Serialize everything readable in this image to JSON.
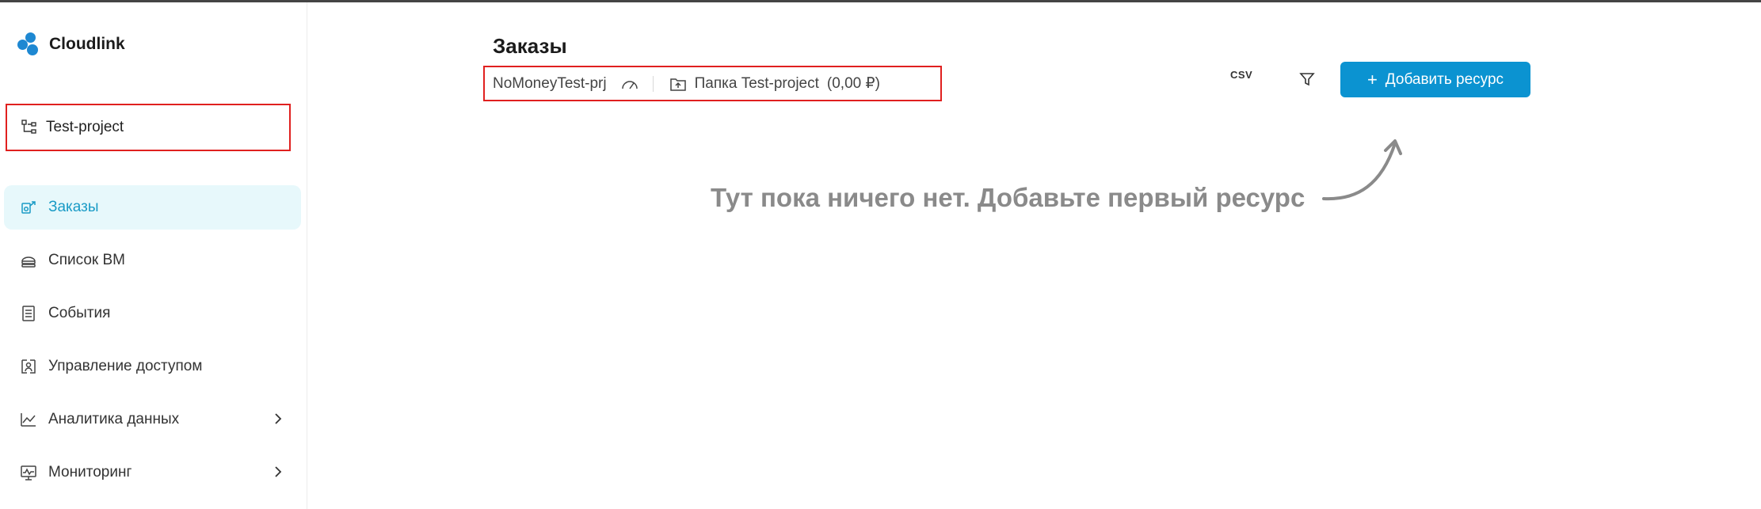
{
  "app": {
    "name": "Cloudlink"
  },
  "project": {
    "name": "Test-project"
  },
  "sidebar": {
    "items": [
      {
        "label": "Заказы",
        "active": true,
        "icon": "orders-icon"
      },
      {
        "label": "Список ВМ",
        "active": false,
        "icon": "vm-list-icon"
      },
      {
        "label": "События",
        "active": false,
        "icon": "events-icon"
      },
      {
        "label": "Управление доступом",
        "active": false,
        "icon": "access-icon"
      },
      {
        "label": "Аналитика данных",
        "active": false,
        "icon": "analytics-icon",
        "expandable": true
      },
      {
        "label": "Мониторинг",
        "active": false,
        "icon": "monitoring-icon",
        "expandable": true
      }
    ]
  },
  "main": {
    "title": "Заказы",
    "project_id": "NoMoneyTest-prj",
    "folder_label": "Папка Test-project",
    "folder_sum": "(0,00 ₽)",
    "csv_label": "CSV",
    "add_button": "Добавить ресурс",
    "empty_message": "Тут пока ничего нет. Добавьте первый ресурс"
  },
  "colors": {
    "accent": "#0b93d1",
    "active_bg": "#e7f8fb",
    "active_text": "#1a9bc6",
    "highlight_border": "#e0201f",
    "empty_text": "#8a8a8a"
  }
}
